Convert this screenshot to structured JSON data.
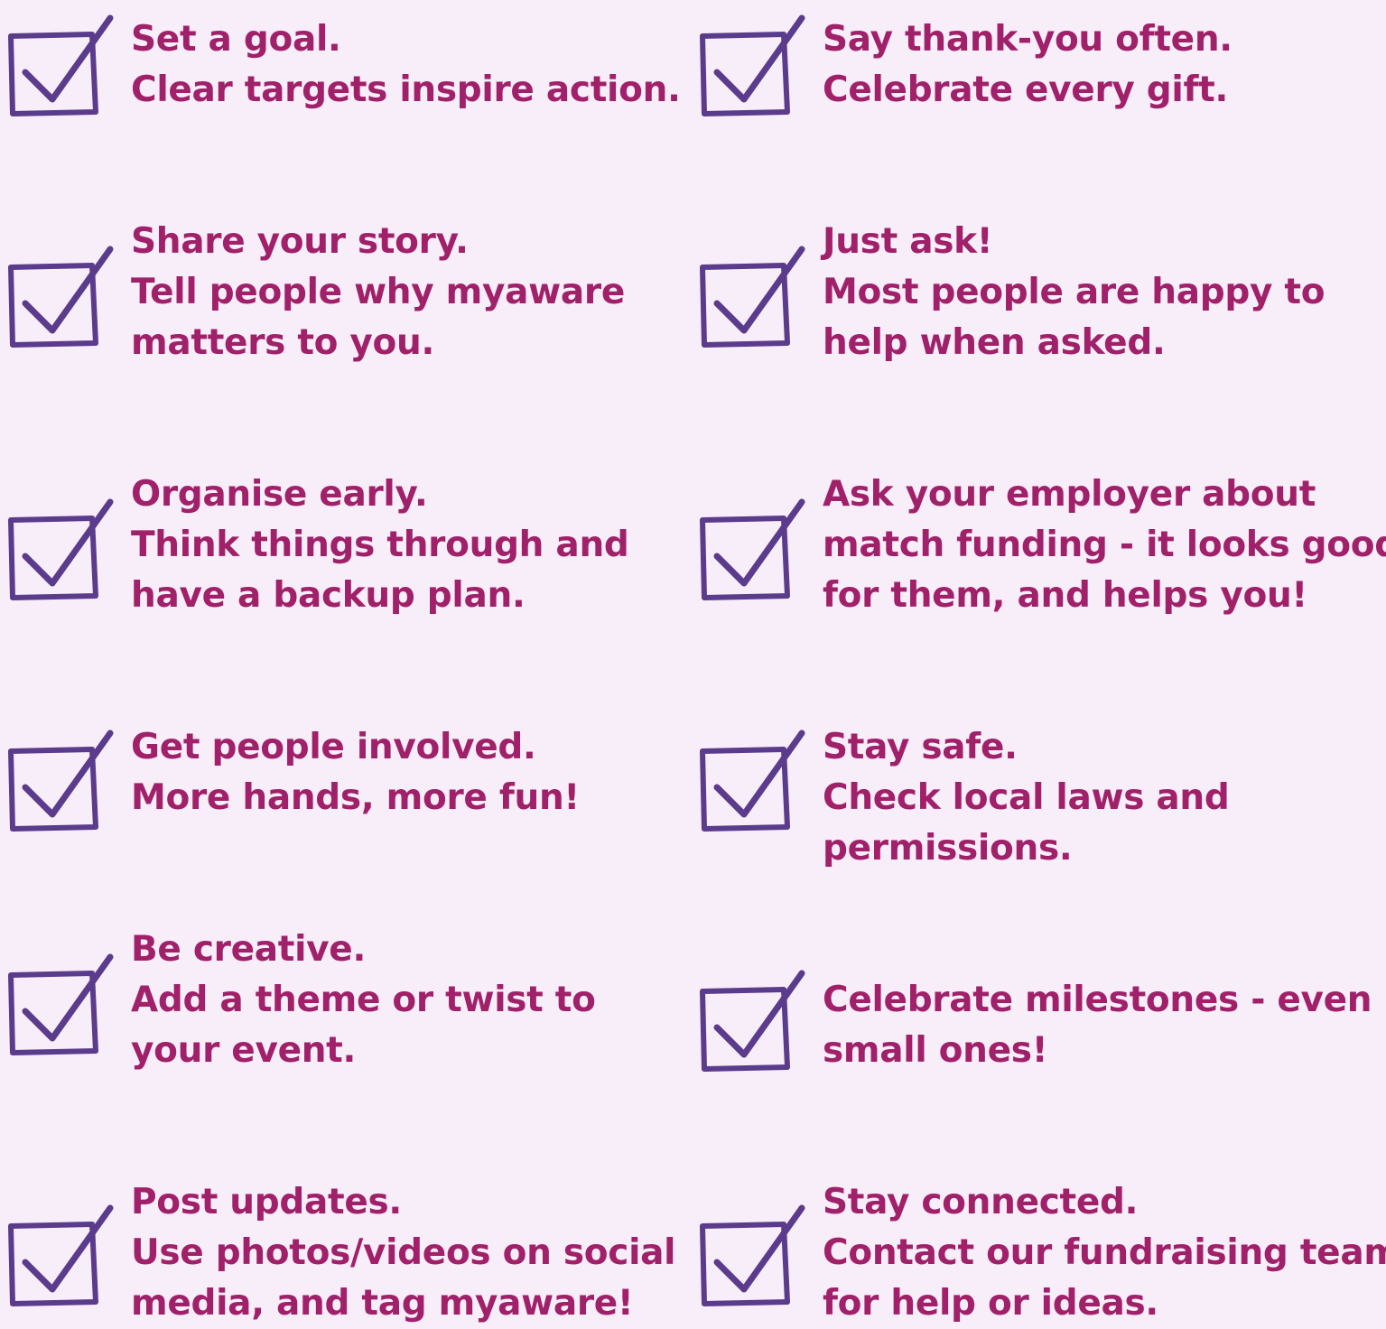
{
  "colors": {
    "background": "#f8eef9",
    "text": "#a0216a",
    "checkbox": "#5a3b8c"
  },
  "tips_left": [
    {
      "lines": [
        "Set a goal.",
        "Clear targets inspire action."
      ]
    },
    {
      "lines": [
        "Share your story.",
        "Tell people why myaware",
        "matters to you."
      ]
    },
    {
      "lines": [
        "Organise early.",
        "Think things through and",
        "have a backup plan."
      ]
    },
    {
      "lines": [
        "Get people involved.",
        "More hands, more fun!"
      ]
    },
    {
      "lines": [
        "Be creative.",
        "Add a theme or twist to",
        "your event."
      ]
    },
    {
      "lines": [
        "Post updates.",
        "Use photos/videos on social",
        "media, and tag myaware!"
      ]
    }
  ],
  "tips_right": [
    {
      "lines": [
        "Say thank-you often.",
        "Celebrate every gift."
      ]
    },
    {
      "lines": [
        "Just ask!",
        "Most people are happy to",
        "help when asked."
      ]
    },
    {
      "lines": [
        "Ask your employer about",
        "match funding - it looks good",
        "for them, and helps you!"
      ]
    },
    {
      "lines": [
        "Stay safe.",
        "Check local laws and",
        "permissions."
      ]
    },
    {
      "lines": [
        "Celebrate milestones - even",
        "small ones!"
      ]
    },
    {
      "lines": [
        "Stay connected.",
        "Contact our fundraising team",
        "for help or ideas."
      ]
    }
  ]
}
